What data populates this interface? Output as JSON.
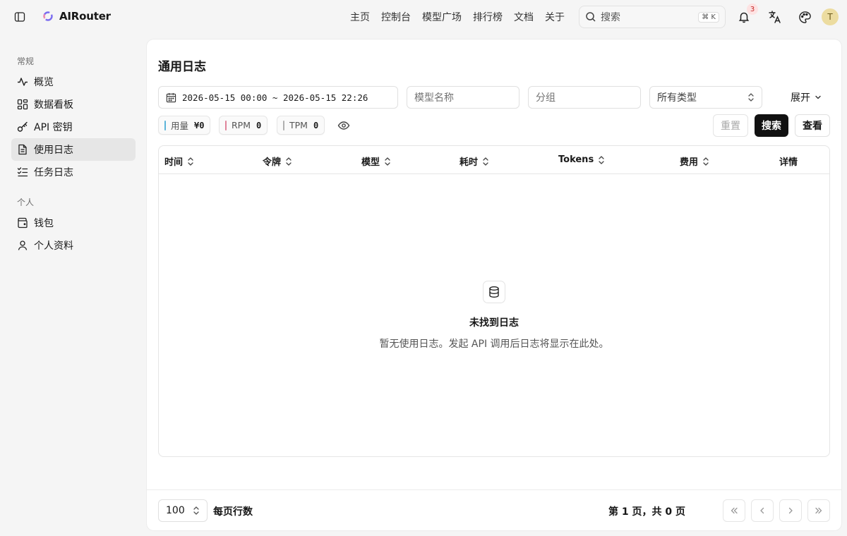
{
  "app": {
    "brand": "AIRouter"
  },
  "nav": [
    "主页",
    "控制台",
    "模型广场",
    "排行榜",
    "文档",
    "关于"
  ],
  "search": {
    "placeholder": "搜索",
    "shortcut": "⌘ K"
  },
  "notifications": {
    "count": "3"
  },
  "user": {
    "initial": "T"
  },
  "sidebar": {
    "section_general": "常规",
    "section_personal": "个人",
    "items": [
      {
        "label": "概览",
        "icon": "activity-icon"
      },
      {
        "label": "数据看板",
        "icon": "grid-icon"
      },
      {
        "label": "API 密钥",
        "icon": "key-icon"
      },
      {
        "label": "使用日志",
        "icon": "file-text-icon",
        "active": true
      },
      {
        "label": "任务日志",
        "icon": "list-check-icon"
      },
      {
        "label": "钱包",
        "icon": "wallet-icon"
      },
      {
        "label": "个人资料",
        "icon": "user-icon"
      }
    ]
  },
  "main": {
    "title": "通用日志",
    "filters": {
      "date_range": "2026-05-15 00:00 ~ 2026-05-15 22:26",
      "model_placeholder": "模型名称",
      "group_placeholder": "分组",
      "type_value": "所有类型",
      "expand_label": "展开"
    },
    "stats": {
      "usage_label": "用量",
      "usage_value": "¥0",
      "rpm_label": "RPM",
      "rpm_value": "0",
      "tpm_label": "TPM",
      "tpm_value": "0"
    },
    "buttons": {
      "reset": "重置",
      "search": "搜索",
      "view": "查看"
    },
    "columns": [
      "时间",
      "令牌",
      "模型",
      "耗时",
      "Tokens",
      "费用",
      "详情"
    ],
    "empty": {
      "title": "未找到日志",
      "description": "暂无使用日志。发起 API 调用后日志将显示在此处。"
    },
    "pagination": {
      "page_size": "100",
      "page_size_label": "每页行数",
      "page_info": "第 1 页，共 0 页"
    }
  },
  "colors": {
    "usage_bar": "#5bb4d9",
    "rpm_bar": "#e0849a",
    "tpm_bar": "#b0b0b0",
    "badge_bg": "#fde2e2",
    "badge_text": "#c62828"
  }
}
